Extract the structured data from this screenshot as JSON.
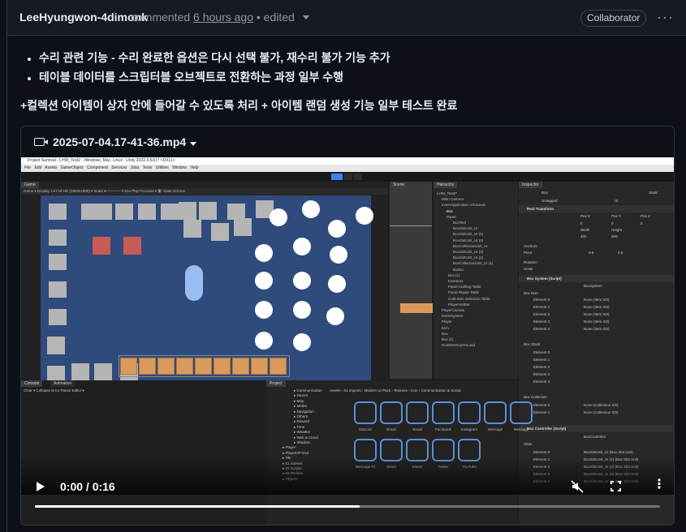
{
  "comment": {
    "author": "LeeHyungwon-4dimonk",
    "action": "commented",
    "time": "6 hours ago",
    "edited": "• edited",
    "badge": "Collaborator",
    "more": "···"
  },
  "body": {
    "bullets": [
      "수리 관련 기능 - 수리 완료한 옵션은 다시 선택 불가, 재수리 불가 기능 추가",
      "테이블 데이터를 스크립터블 오브젝트로 전환하는 과정 일부 수행"
    ],
    "paragraph": "+컬렉션 아이템이 상자 안에 들어갈 수 있도록 처리 + 아이템 랜덤 생성 기능 일부 테스트 완료"
  },
  "video": {
    "file_name": "2025-07-04.17-41-36.mp4",
    "time_display": "0:00 / 0:16",
    "progress": 0.52,
    "icons": {
      "file": "video-camera-icon",
      "play": "play-icon",
      "mute": "muted-speaker-icon",
      "fullscreen": "fullscreen-icon",
      "menu": "vertical-dots-icon"
    }
  },
  "unity": {
    "title": "Project Survival - LHW_Test2 - Windows, Mac, Linux - Unity 2022.3.61f1* <DX11>",
    "menu": "File Edit Assets GameObject Component Services Jobs Tools Utilities Window Help",
    "game_tab": "Game",
    "game_bar": "Game   ▾  Display 1  ▾  Full HD (1920x1080)  ▾  Scale ●———— 0.51x        Play Focused  ▾   🔇  Stats  Gizmos",
    "scene_tab": "Scene",
    "hierarchy_tab": "Hierarchy",
    "hierarchy_items": [
      "LHW_Test2*",
      "Main Camera",
      "InvenApplication UICanvas",
      "Box",
      "Panel",
      "BoxText",
      "BoxSlotUnit_UI",
      "BoxSlotUnit_UI (1)",
      "BoxSlotUnit_UI (2)",
      "BoxCollectionUnit_UI",
      "BoxSlotUnit_UI (3)",
      "BoxSlotUnit_UI (4)",
      "BoxCollectionUnit_UI (1)",
      "Button",
      "Box (1)",
      "Inventory",
      "Panel Crafting Table",
      "Panel Repair Table",
      "Craft Item Selection Table",
      "PlayerHotBar",
      "PlayerCanvas",
      "EventSystem",
      "Player",
      "Item",
      "Box",
      "Box (1)",
      "DontDestroyOnLoad"
    ],
    "inspector_tab": "Inspector",
    "inspector_name": "Box",
    "inspector_static": "Static",
    "inspector_tag": "Untagged",
    "inspector_layer": "UI",
    "rect_transform": "Rect Transform",
    "rect_labels": [
      "Pos X",
      "Pos Y",
      "Pos Z",
      "Width",
      "Height"
    ],
    "rect_values": [
      "0",
      "0",
      "0",
      "400",
      "500"
    ],
    "anchors": "Anchors",
    "pivot": "Pivot",
    "pivot_values": [
      "0.5",
      "0.5"
    ],
    "rotation": "Rotation",
    "scale": "Scale",
    "box_system": "Box System (Script)",
    "box_system_script": "BoxSystem",
    "box_item": "Box Item",
    "elements": [
      "Element 0",
      "Element 1",
      "Element 2",
      "Element 3",
      "Element 4"
    ],
    "none_item": "None (Item SO)",
    "box_stack": "Box Stack",
    "box_collection": "Box Collection",
    "none_collection": "None (Collection SO)",
    "box_controller": "Box Controller (Script)",
    "box_controller_script": "BoxController",
    "slots": "Slots",
    "slot_items": [
      "BoxSlotUnit_UI (Box Slot Unit)",
      "BoxSlotUnit_UI (1) (Box Slot Unit)",
      "BoxSlotUnit_UI (2) (Box Slot Unit)",
      "BoxSlotUnit_UI (3) (Box Slot Unit)",
      "BoxSlotUnit_UI (4) (Box Slot Unit)"
    ],
    "console_tab": "Console",
    "animation_tab": "Animation",
    "console_bar": "Clear  ▾  Collapse  Error Pause  Editor ▾",
    "project_tab": "Project",
    "project_path": "Assets › 01.Imports › Modern UI Pack › Textures › Icon › Communication & Social",
    "project_folders": [
      "Communication",
      "Device",
      "Map",
      "Media",
      "Navigation",
      "Others",
      "Reward",
      "Time",
      "Weather",
      "Web & Cloud",
      "Shadow",
      "Player",
      "PlayerHP-GUI",
      "Tile",
      "01.Scenes",
      "02.Scripts",
      "03.Prefabs",
      "Objects"
    ],
    "project_icons": [
      "Discord",
      "Email",
      "Email",
      "Facebook",
      "Instagram",
      "Message",
      "Message",
      "Message Fil",
      "Share",
      "Steam",
      "Twitter",
      "YouTube"
    ]
  }
}
